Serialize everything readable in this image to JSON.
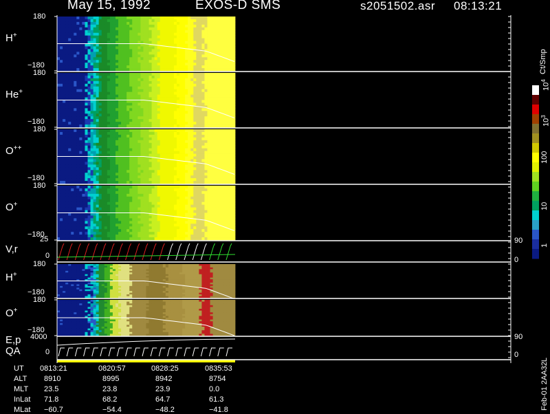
{
  "header": {
    "date": "May 15, 1992",
    "instrument": "EXOS-D SMS",
    "file": "s2051502.asr",
    "time": "08:13:21"
  },
  "colorbar": {
    "units": "Ct/Smp",
    "ticks": [
      "1",
      "10",
      "100",
      "10",
      "10"
    ],
    "tick_superscripts": [
      "",
      "",
      "",
      "3",
      "4"
    ],
    "colors": [
      "#0a1a82",
      "#1a2ea0",
      "#2a56c8",
      "#2aa0c8",
      "#00d0d0",
      "#00a060",
      "#20b040",
      "#60d020",
      "#a0e020",
      "#e0f000",
      "#ffff00",
      "#d0c800",
      "#a09020",
      "#807030",
      "#a04000",
      "#e00000",
      "#600000",
      "#ffffff"
    ]
  },
  "panels": [
    {
      "id": "h-plus",
      "label": "H",
      "sup": "+",
      "ytop": "180",
      "ybottom": "−180"
    },
    {
      "id": "he-plus",
      "label": "He",
      "sup": "+",
      "ytop": "180",
      "ybottom": "−180"
    },
    {
      "id": "o-plusplus",
      "label": "O",
      "sup": "++",
      "ytop": "180",
      "ybottom": "−180"
    },
    {
      "id": "o-plus",
      "label": "O",
      "sup": "+",
      "ytop": "180",
      "ybottom": "−180"
    }
  ],
  "vr_panel": {
    "label": "V,r",
    "ytop": "25",
    "ybottom": "0",
    "right_top": "90",
    "right_bottom": "0"
  },
  "panels2": [
    {
      "id": "h-plus-2",
      "label": "H",
      "sup": "+",
      "ytop": "180",
      "ybottom": "−180"
    },
    {
      "id": "o-plus-2",
      "label": "O",
      "sup": "+",
      "ytop": "180",
      "ybottom": "−180"
    }
  ],
  "ep_panel": {
    "label": "E,p",
    "label2": "QA",
    "ytop": "4000",
    "ybottom": "0",
    "right_top": "90",
    "right_bottom": "0"
  },
  "ephemeris": {
    "rows": [
      "UT",
      "ALT",
      "MLT",
      "InLat",
      "MLat"
    ],
    "columns": [
      [
        "0813:21",
        "8910",
        "23.5",
        "71.8",
        "−60.7"
      ],
      [
        "0820:57",
        "8995",
        "23.8",
        "68.2",
        "−54.4"
      ],
      [
        "0828:25",
        "8942",
        "23.9",
        "64.7",
        "−48.2"
      ],
      [
        "0835:53",
        "8754",
        "0.0",
        "61.3",
        "−41.8"
      ]
    ]
  },
  "footer_right": "Feb-01 2AA32L",
  "chart_data": {
    "type": "heatmap",
    "x_range": [
      "0813:21",
      "0835:53"
    ],
    "y_range": [
      -180,
      180
    ],
    "data_coverage": "approximately first half of time axis (ends near 0828:25 + ~2 min)",
    "colorscale_units": "Ct/Smp",
    "colorscale_range": [
      1,
      10000
    ],
    "series": [
      {
        "name": "H+"
      },
      {
        "name": "He+"
      },
      {
        "name": "O++"
      },
      {
        "name": "O+"
      },
      {
        "name": "V,r"
      },
      {
        "name": "H+"
      },
      {
        "name": "O+"
      },
      {
        "name": "E,p"
      }
    ]
  }
}
